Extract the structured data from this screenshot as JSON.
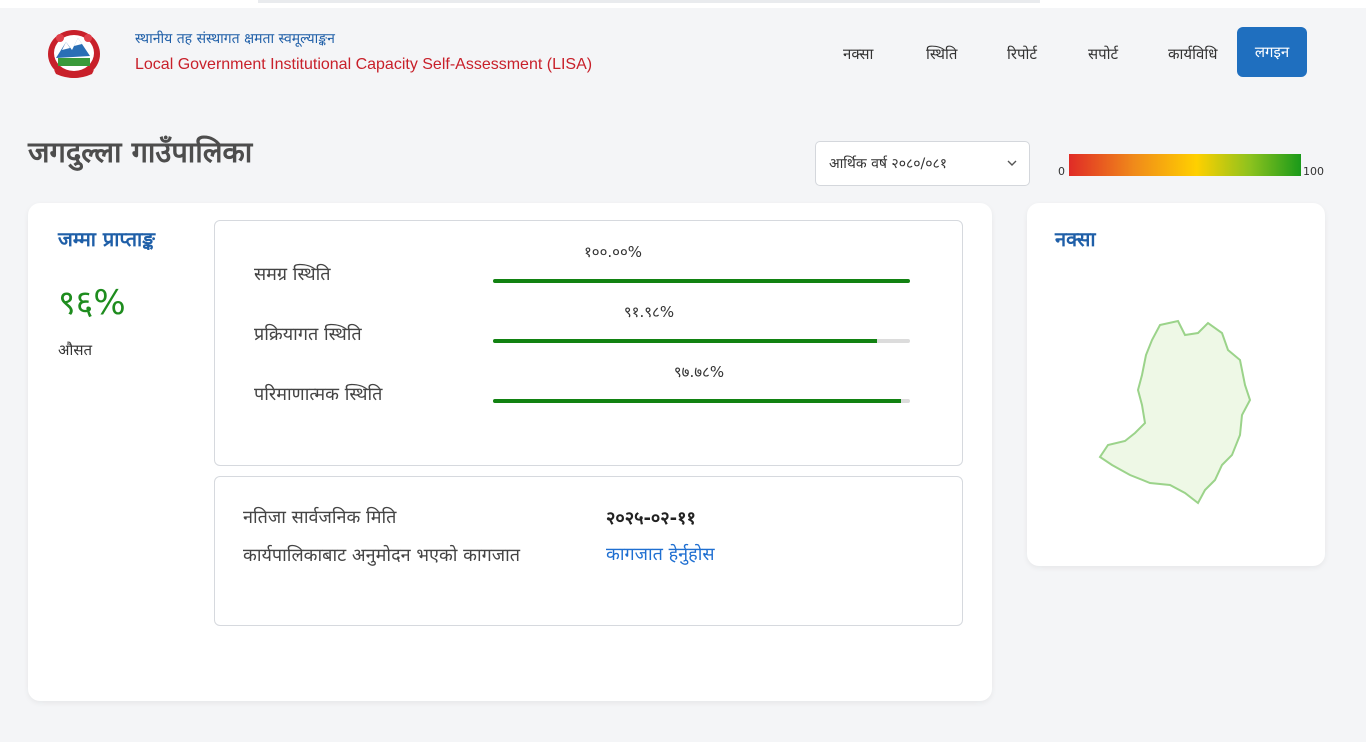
{
  "header": {
    "brand_np": "स्थानीय तह संस्थागत क्षमता स्वमूल्याङ्कन",
    "brand_en": "Local Government Institutional Capacity Self-Assessment (LISA)",
    "nav": [
      "नक्सा",
      "स्थिति",
      "रिपोर्ट",
      "सपोर्ट",
      "कार्यविधि"
    ],
    "login_label": "लगइन"
  },
  "page": {
    "title": "जगदुल्ला गाउँपालिका",
    "year_select": {
      "value": "आर्थिक वर्ष २०८०/०८१"
    },
    "scale": {
      "min": "0",
      "max": "100"
    }
  },
  "score": {
    "title": "जम्मा प्राप्ताङ्क",
    "value": "९६%",
    "subtitle": "औसत"
  },
  "status_rows": [
    {
      "label": "समग्र स्थिति",
      "percent_text": "१००.००%",
      "percent": 100.0
    },
    {
      "label": "प्रक्रियागत स्थिति",
      "percent_text": "९१.९८%",
      "percent": 91.98
    },
    {
      "label": "परिमाणात्मक स्थिति",
      "percent_text": "९७.७८%",
      "percent": 97.78
    }
  ],
  "result": {
    "published_label": "नतिजा सार्वजनिक मिति",
    "published_date": "२०२५-०२-११",
    "approved_label": "कार्यपालिकाबाट अनुमोदन भएको कागजात",
    "approved_link": "कागजात हेर्नुहोस"
  },
  "map": {
    "title": "नक्सा",
    "fill_color": "#eef8e6",
    "stroke_color": "#9bd38a"
  },
  "colors": {
    "primary": "#1f5fa8",
    "button": "#1f6fbf",
    "success": "#128212",
    "brand_red": "#c8202a"
  }
}
